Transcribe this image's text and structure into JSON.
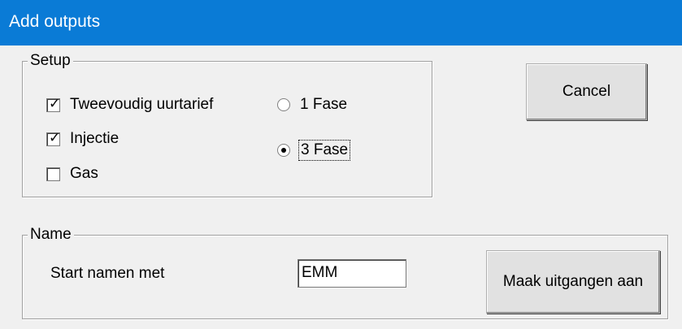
{
  "window": {
    "title": "Add outputs",
    "title_bar_color": "#0a7bd6"
  },
  "setup": {
    "legend": "Setup",
    "checkboxes": [
      {
        "label": "Tweevoudig uurtarief",
        "checked": true
      },
      {
        "label": "Injectie",
        "checked": true
      },
      {
        "label": "Gas",
        "checked": false
      }
    ],
    "radios": [
      {
        "label": "1 Fase",
        "selected": false
      },
      {
        "label": "3 Fase",
        "selected": true
      }
    ]
  },
  "cancel_label": "Cancel",
  "name": {
    "legend": "Name",
    "start_label": "Start namen met",
    "start_value": "EMM",
    "create_button_label": "Maak uitgangen aan"
  }
}
